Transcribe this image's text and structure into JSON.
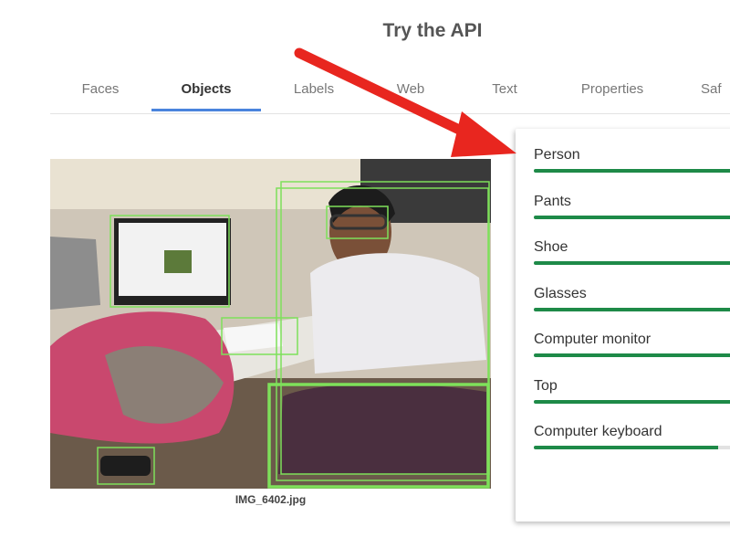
{
  "header": {
    "title": "Try the API"
  },
  "tabs": [
    {
      "label": "Faces",
      "active": false
    },
    {
      "label": "Objects",
      "active": true
    },
    {
      "label": "Labels",
      "active": false
    },
    {
      "label": "Web",
      "active": false
    },
    {
      "label": "Text",
      "active": false
    },
    {
      "label": "Properties",
      "active": false
    },
    {
      "label": "Saf",
      "active": false
    }
  ],
  "image": {
    "filename": "IMG_6402.jpg"
  },
  "results": [
    {
      "label": "Person",
      "confidence": 1.0
    },
    {
      "label": "Pants",
      "confidence": 1.0
    },
    {
      "label": "Shoe",
      "confidence": 1.0
    },
    {
      "label": "Glasses",
      "confidence": 1.0
    },
    {
      "label": "Computer monitor",
      "confidence": 1.0
    },
    {
      "label": "Top",
      "confidence": 1.0
    },
    {
      "label": "Computer keyboard",
      "confidence": 0.84
    }
  ],
  "colors": {
    "accent": "#4a84dd",
    "bar_fill": "#1e8a48",
    "box": "#7ee05a",
    "arrow": "#e8261f"
  }
}
